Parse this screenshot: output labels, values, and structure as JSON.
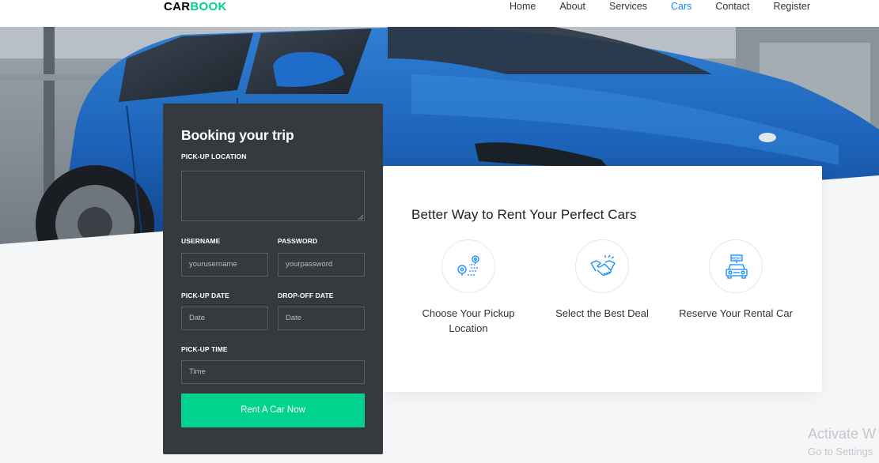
{
  "brand": {
    "name_part1": "CAR",
    "name_part2": "BOOK",
    "accent_color": "#01d28e"
  },
  "nav": {
    "items": [
      {
        "label": "Home"
      },
      {
        "label": "About"
      },
      {
        "label": "Services"
      },
      {
        "label": "Cars",
        "active": true
      },
      {
        "label": "Contact"
      },
      {
        "label": "Register"
      }
    ],
    "active_color": "#1089ff"
  },
  "booking": {
    "title": "Booking your trip",
    "pickup_location_label": "PICK-UP LOCATION",
    "pickup_location_value": "",
    "username_label": "USERNAME",
    "username_placeholder": "yourusername",
    "password_label": "PASSWORD",
    "password_placeholder": "yourpassword",
    "pickup_date_label": "PICK-UP DATE",
    "pickup_date_placeholder": "Date",
    "dropoff_date_label": "DROP-OFF DATE",
    "dropoff_date_placeholder": "Date",
    "pickup_time_label": "PICK-UP TIME",
    "pickup_time_placeholder": "Time",
    "submit_label": "Rent A Car Now",
    "panel_color": "#36393e",
    "button_color": "#01d28e"
  },
  "features": {
    "heading": "Better Way to Rent Your Perfect Cars",
    "steps": [
      {
        "icon": "route-pin-icon",
        "label": "Choose Your Pickup Location"
      },
      {
        "icon": "handshake-icon",
        "label": "Select the Best Deal"
      },
      {
        "icon": "rent-car-icon",
        "label": "Reserve Your Rental Car"
      }
    ],
    "icon_color": "#1089ff"
  },
  "watermark": {
    "line1": "Activate W",
    "line2": "Go to Settings"
  }
}
